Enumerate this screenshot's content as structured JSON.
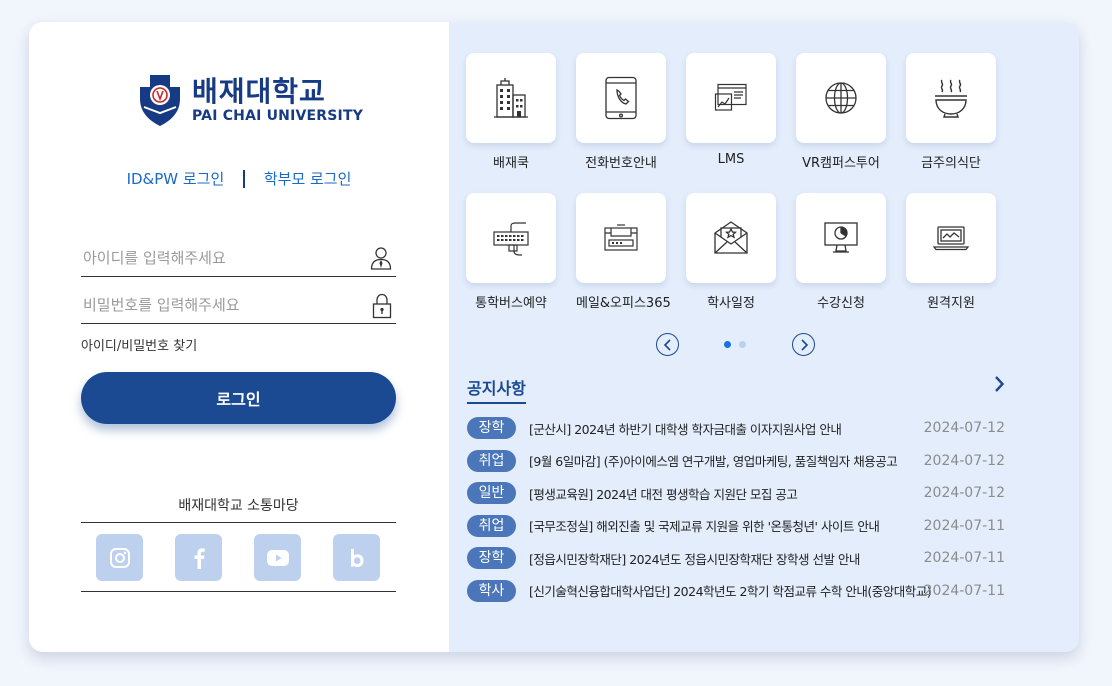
{
  "brand": {
    "name_kr": "배재대학교",
    "name_en": "PAI CHAI UNIVERSITY",
    "color": "#173a84"
  },
  "login": {
    "tab_idpw": "ID&PW 로그인",
    "tab_parent": "학부모 로그인",
    "id_placeholder": "아이디를 입력해주세요",
    "pw_placeholder": "비밀번호를 입력해주세요",
    "find_link": "아이디/비밀번호 찾기",
    "button": "로그인"
  },
  "sns": {
    "title": "배재대학교 소통마당",
    "links": [
      "instagram-icon",
      "facebook-icon",
      "youtube-icon",
      "blog-icon"
    ]
  },
  "quick_menu": [
    {
      "label": "배재쿡",
      "icon": "buildings-icon"
    },
    {
      "label": "전화번호안내",
      "icon": "tablet-phone-icon"
    },
    {
      "label": "LMS",
      "icon": "lms-chart-icon"
    },
    {
      "label": "VR캠퍼스투어",
      "icon": "globe-icon"
    },
    {
      "label": "금주의식단",
      "icon": "food-bowl-icon"
    },
    {
      "label": "통학버스예약",
      "icon": "keyboard-icon"
    },
    {
      "label": "메일&오피스365",
      "icon": "mail-box-icon"
    },
    {
      "label": "학사일정",
      "icon": "envelope-icon"
    },
    {
      "label": "수강신청",
      "icon": "monitor-icon"
    },
    {
      "label": "원격지원",
      "icon": "laptop-icon"
    }
  ],
  "notices": {
    "title": "공지사항",
    "items": [
      {
        "category": "장학",
        "text": "[군산시] 2024년 하반기 대학생 학자금대출 이자지원사업 안내",
        "date": "2024-07-12"
      },
      {
        "category": "취업",
        "text": "[9월 6일마감] (주)아이에스엠 연구개발, 영업마케팅, 품질책임자 채용공고",
        "date": "2024-07-12"
      },
      {
        "category": "일반",
        "text": "[평생교육원] 2024년 대전 평생학습 지원단 모집 공고",
        "date": "2024-07-12"
      },
      {
        "category": "취업",
        "text": "[국무조정실] 해외진출 및 국제교류 지원을 위한 '온통청년' 사이트 안내",
        "date": "2024-07-11"
      },
      {
        "category": "장학",
        "text": "[정읍시민장학재단] 2024년도 정읍시민장학재단 장학생 선발 안내",
        "date": "2024-07-11"
      },
      {
        "category": "학사",
        "text": "[신기술혁신융합대학사업단] 2024학년도 2학기 학점교류 수학 안내(중앙대학교)",
        "date": "2024-07-11"
      }
    ]
  },
  "colors": {
    "accent": "#1b4a92",
    "badge": "#4b77ba",
    "panel": "#e3edfb"
  }
}
